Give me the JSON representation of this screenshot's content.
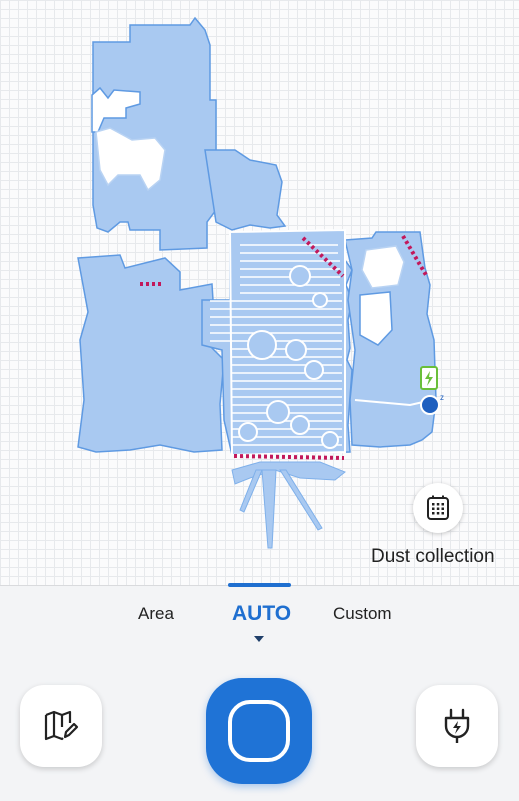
{
  "map": {
    "dust_collection_label": "Dust collection",
    "floor_color": "#a9c9f1",
    "floor_edge_color": "#4e8fe0",
    "pattern_color": "#ffffff",
    "no_go_line_color": "#c2185b",
    "dock_color": "#6abf3a",
    "robot_color": "#1e5fbf"
  },
  "modes": {
    "items": [
      "Area",
      "AUTO",
      "Custom"
    ],
    "selected": "AUTO",
    "accent_color": "#1f6fd0"
  },
  "controls": {
    "map_edit_icon": "map-edit-icon",
    "start_icon": "start-clean-icon",
    "dock_icon": "plug-icon",
    "start_color": "#1f73d6"
  }
}
